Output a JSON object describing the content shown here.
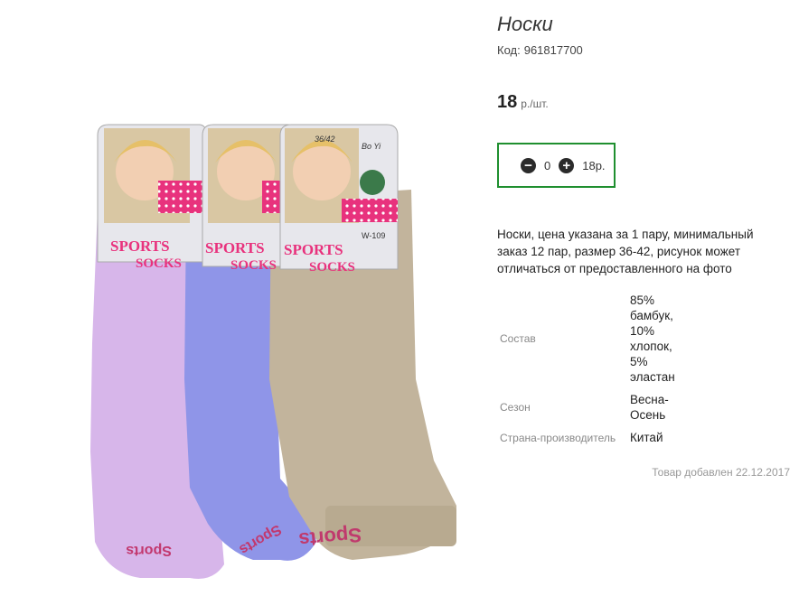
{
  "product": {
    "title": "Носки",
    "code_label": "Код:",
    "code": "961817700",
    "price": "18",
    "price_unit": "р./шт.",
    "description": "Носки, цена указана за 1 пару, минимальный заказ 12 пар, размер 36-42, рисунок может отличаться от предоставленного на фото",
    "added": "Товар добавлен 22.12.2017"
  },
  "cart": {
    "minus_icon": "minus-circle-icon",
    "plus_icon": "plus-circle-icon",
    "quantity": "0",
    "sum": "18р."
  },
  "props": [
    {
      "key": "Состав",
      "value": "85% бамбук, 10% хлопок, 5% эластан"
    },
    {
      "key": "Сезон",
      "value": "Весна-Осень"
    },
    {
      "key": "Страна-производитель",
      "value": "Китай"
    }
  ],
  "packaging": {
    "size": "36/42",
    "brand": "Bo Yi",
    "model": "W-109",
    "line1": "SPORTS",
    "line2": "SOCKS",
    "sock_print": "Sports"
  },
  "colors": {
    "accent_border": "#1f8f2f",
    "sock_lilac": "#d7b6ea",
    "sock_blue": "#8f95e8",
    "sock_beige": "#c2b49c"
  }
}
